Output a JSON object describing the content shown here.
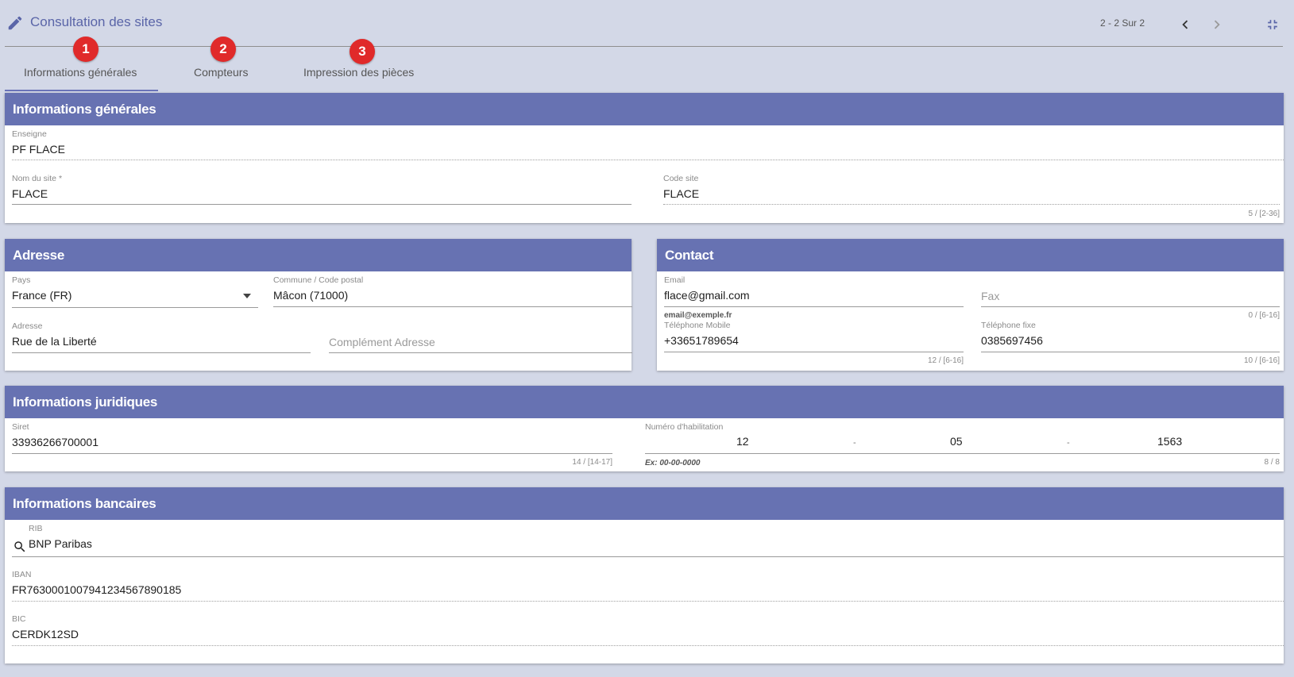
{
  "header": {
    "title": "Consultation des sites",
    "pager": "2 - 2 Sur 2",
    "icons": {
      "edit": "pencil-icon",
      "prev": "chevron-left-icon",
      "next": "chevron-right-icon",
      "collapse": "fullscreen-exit-icon"
    }
  },
  "tabs": [
    {
      "label": "Informations générales",
      "badge": "1"
    },
    {
      "label": "Compteurs",
      "badge": "2"
    },
    {
      "label": "Impression des pièces",
      "badge": "3"
    }
  ],
  "general": {
    "title": "Informations générales",
    "enseigne_label": "Enseigne",
    "enseigne_value": "PF FLACE",
    "nom_label": "Nom du site *",
    "nom_value": "FLACE",
    "code_label": "Code site",
    "code_value": "FLACE",
    "code_counter": "5 / [2-36]"
  },
  "adresse": {
    "title": "Adresse",
    "pays_label": "Pays",
    "pays_value": "France (FR)",
    "commune_label": "Commune / Code postal",
    "commune_value": "Mâcon (71000)",
    "adresse_label": "Adresse",
    "adresse_value": "Rue de la Liberté",
    "complement_placeholder": "Complément Adresse"
  },
  "contact": {
    "title": "Contact",
    "email_label": "Email",
    "email_value": "flace@gmail.com",
    "email_hint": "email@exemple.fr",
    "fax_placeholder": "Fax",
    "fax_counter": "0 / [6-16]",
    "mobile_label": "Téléphone Mobile",
    "mobile_value": "+33651789654",
    "mobile_counter": "12 / [6-16]",
    "fixe_label": "Téléphone fixe",
    "fixe_value": "0385697456",
    "fixe_counter": "10 / [6-16]"
  },
  "juridique": {
    "title": "Informations juridiques",
    "siret_label": "Siret",
    "siret_value": "33936266700001",
    "siret_counter": "14 / [14-17]",
    "habil_label": "Numéro d'habilitation",
    "habil_part1": "12",
    "habil_part2": "05",
    "habil_part3": "1563",
    "habil_sep": "-",
    "habil_hint": "Ex: 00-00-0000",
    "habil_counter": "8 / 8"
  },
  "bancaire": {
    "title": "Informations bancaires",
    "rib_label": "RIB",
    "rib_value": "BNP Paribas",
    "iban_label": "IBAN",
    "iban_value": "FR7630001007941234567890185",
    "bic_label": "BIC",
    "bic_value": "CERDK12SD"
  },
  "colors": {
    "accent": "#6772b2",
    "badge": "#e02a2a",
    "background": "#d3d8e7"
  }
}
